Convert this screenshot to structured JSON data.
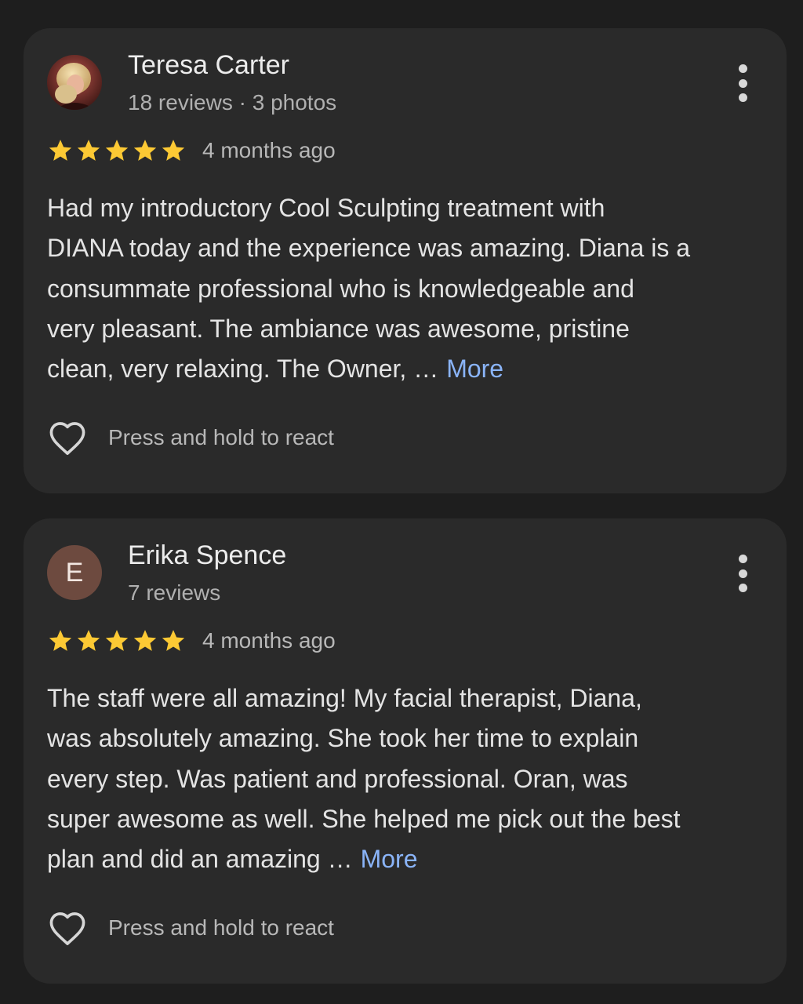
{
  "colors": {
    "background": "#1e1e1e",
    "card": "#2a2a2a",
    "star": "#fcc934",
    "link": "#8ab4f8",
    "avatar_letter_bg": "#6d4a3f"
  },
  "reviews": [
    {
      "reviewer_name": "Teresa Carter",
      "reviewer_meta": "18 reviews · 3 photos",
      "avatar": "photo",
      "rating": 5,
      "date": "4 months ago",
      "text_lines": [
        "Had my introductory Cool Sculpting treatment with",
        "DIANA today and the experience was amazing. Diana is a",
        "consummate professional who is knowledgeable and",
        "very pleasant. The ambiance was awesome, pristine",
        "clean, very relaxing. The Owner, …"
      ],
      "more_label": "More",
      "react_label": "Press and hold to react"
    },
    {
      "reviewer_name": "Erika Spence",
      "reviewer_meta": "7 reviews",
      "avatar": "E",
      "rating": 5,
      "date": "4 months ago",
      "text_lines": [
        "The staff were all amazing! My facial therapist, Diana,",
        "was absolutely amazing. She took her time to explain",
        "every step. Was patient and professional. Oran, was",
        "super awesome as well. She helped me pick out the best",
        "plan and did an amazing …"
      ],
      "more_label": "More",
      "react_label": "Press and hold to react"
    }
  ],
  "icons": {
    "options": "more-vert-icon",
    "react": "heart-outline-icon",
    "rating": "star-icon"
  }
}
